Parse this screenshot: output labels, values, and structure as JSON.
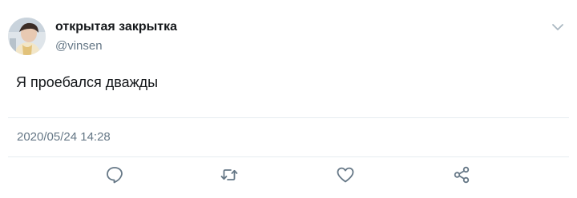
{
  "tweet": {
    "author": {
      "display_name": "открытая закрытка",
      "handle": "@vinsen",
      "avatar_icon": "profile-photo"
    },
    "menu_icon": "chevron-down-icon",
    "text": "Я проебался дважды",
    "timestamp": "2020/05/24 14:28",
    "actions": {
      "reply_icon": "reply-icon",
      "retweet_icon": "retweet-icon",
      "like_icon": "heart-icon",
      "share_icon": "share-icon"
    }
  },
  "colors": {
    "text_primary": "#14171a",
    "text_secondary": "#657786",
    "icon_color": "#657786",
    "divider": "#e6ecf0",
    "chevron": "#aab8c2"
  }
}
